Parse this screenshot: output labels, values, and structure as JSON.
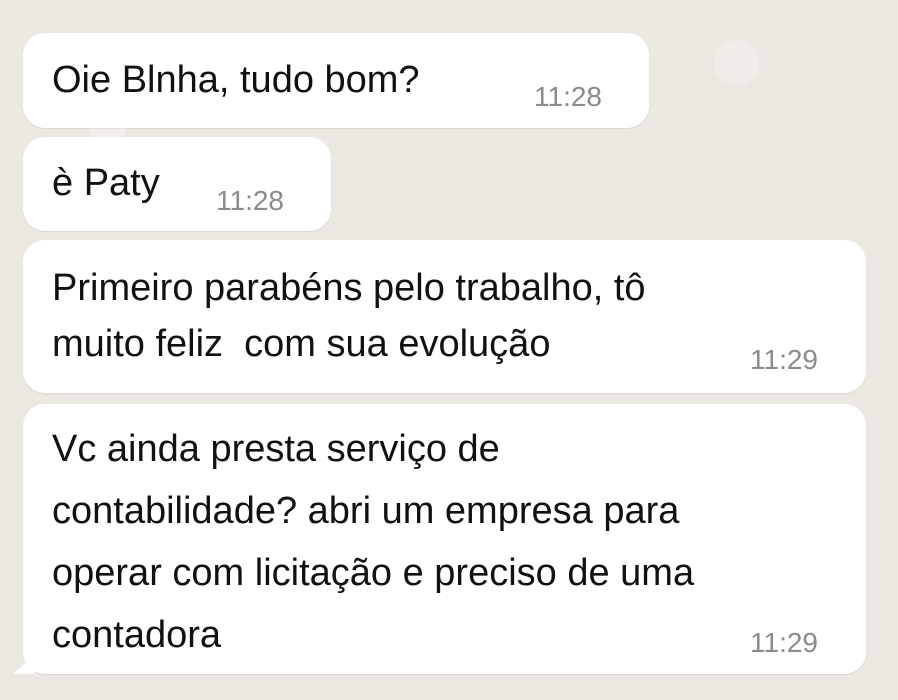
{
  "messages": [
    {
      "text": "Oie Blnha, tudo bom?",
      "time": "11:28"
    },
    {
      "text": "è Paty",
      "time": "11:28"
    },
    {
      "text": "Primeiro parabéns pelo trabalho, tô\nmuito feliz  com sua evolução",
      "time": "11:29"
    },
    {
      "text": "Vc ainda presta serviço de\ncontabilidade? abri um empresa para\noperar com licitação e preciso de uma\ncontadora",
      "time": "11:29"
    }
  ],
  "colors": {
    "background": "#ebe7e1",
    "bubble": "#ffffff",
    "text": "#111111",
    "time": "#8b8b8b"
  }
}
